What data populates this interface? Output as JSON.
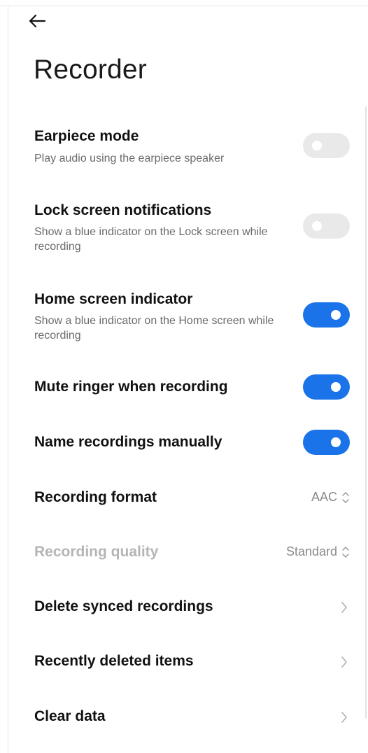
{
  "header": {
    "back_icon": "arrow-left-icon",
    "title": "Recorder"
  },
  "settings": [
    {
      "title": "Earpiece mode",
      "subtitle": "Play audio using the earpiece speaker",
      "control": "toggle",
      "on": false
    },
    {
      "title": "Lock screen notifications",
      "subtitle": "Show a blue indicator on the Lock screen while recording",
      "control": "toggle",
      "on": false
    },
    {
      "title": "Home screen indicator",
      "subtitle": "Show a blue indicator on the Home screen while recording",
      "control": "toggle",
      "on": true
    },
    {
      "title": "Mute ringer when recording",
      "control": "toggle",
      "on": true
    },
    {
      "title": "Name recordings manually",
      "control": "toggle",
      "on": true
    },
    {
      "title": "Recording format",
      "control": "select",
      "value": "AAC"
    },
    {
      "title": "Recording quality",
      "control": "select",
      "value": "Standard",
      "disabled": true
    },
    {
      "title": "Delete synced recordings",
      "control": "chevron"
    },
    {
      "title": "Recently deleted items",
      "control": "chevron"
    },
    {
      "title": "Clear data",
      "control": "chevron"
    }
  ],
  "colors": {
    "accent": "#1a73e8",
    "toggle_off": "#e9e9e9"
  }
}
